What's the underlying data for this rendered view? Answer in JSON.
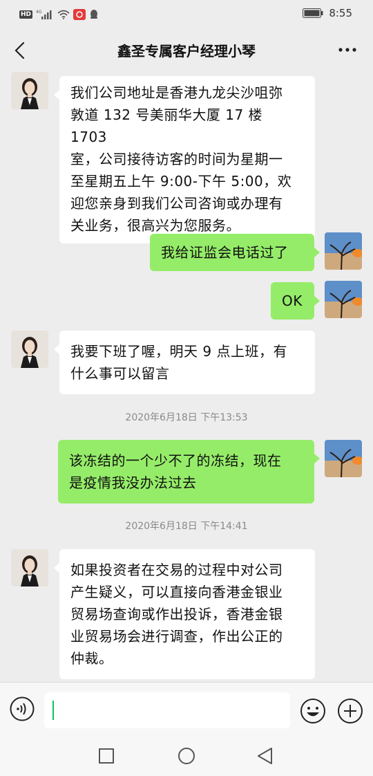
{
  "status_bar": {
    "hd_badge": "HD",
    "network": "4G",
    "time": "8:55"
  },
  "header": {
    "title": "鑫圣专属客户经理小琴",
    "back_icon": "chevron-left-icon",
    "more_icon": "more-horizontal-icon"
  },
  "messages": [
    {
      "side": "in",
      "lines": [
        "我们公司地址是香港九龙尖沙咀弥",
        "敦道 132 号美丽华大厦 17 楼 1703",
        "室，公司接待访客的时间为星期一",
        "至星期五上午 9:00-下午 5:00，欢",
        "迎您亲身到我们公司咨询或办理有",
        "关业务，很高兴为您服务。"
      ]
    },
    {
      "side": "out",
      "lines": [
        "我给证监会电话过了"
      ]
    },
    {
      "side": "out",
      "lines": [
        "OK"
      ]
    },
    {
      "side": "in",
      "lines": [
        "我要下班了喔，明天 9 点上班，有",
        "什么事可以留言"
      ]
    },
    {
      "side": "out",
      "lines": [
        "该冻结的一个少不了的冻结，现在",
        "是疫情我没办法过去"
      ]
    },
    {
      "side": "in",
      "lines": [
        "如果投资者在交易的过程中对公司",
        "产生疑义，可以直接向香港金银业",
        "贸易场查询或作出投诉，香港金银",
        "业贸易场会进行调查，作出公正的",
        "仲裁。"
      ]
    }
  ],
  "timestamps": [
    "2020年6月18日 下午13:53",
    "2020年6月18日 下午14:41"
  ],
  "input": {
    "value": ""
  },
  "colors": {
    "outgoing_bubble": "#95ec69",
    "incoming_bubble": "#ffffff",
    "background": "#ededed",
    "caret": "#07c160"
  }
}
